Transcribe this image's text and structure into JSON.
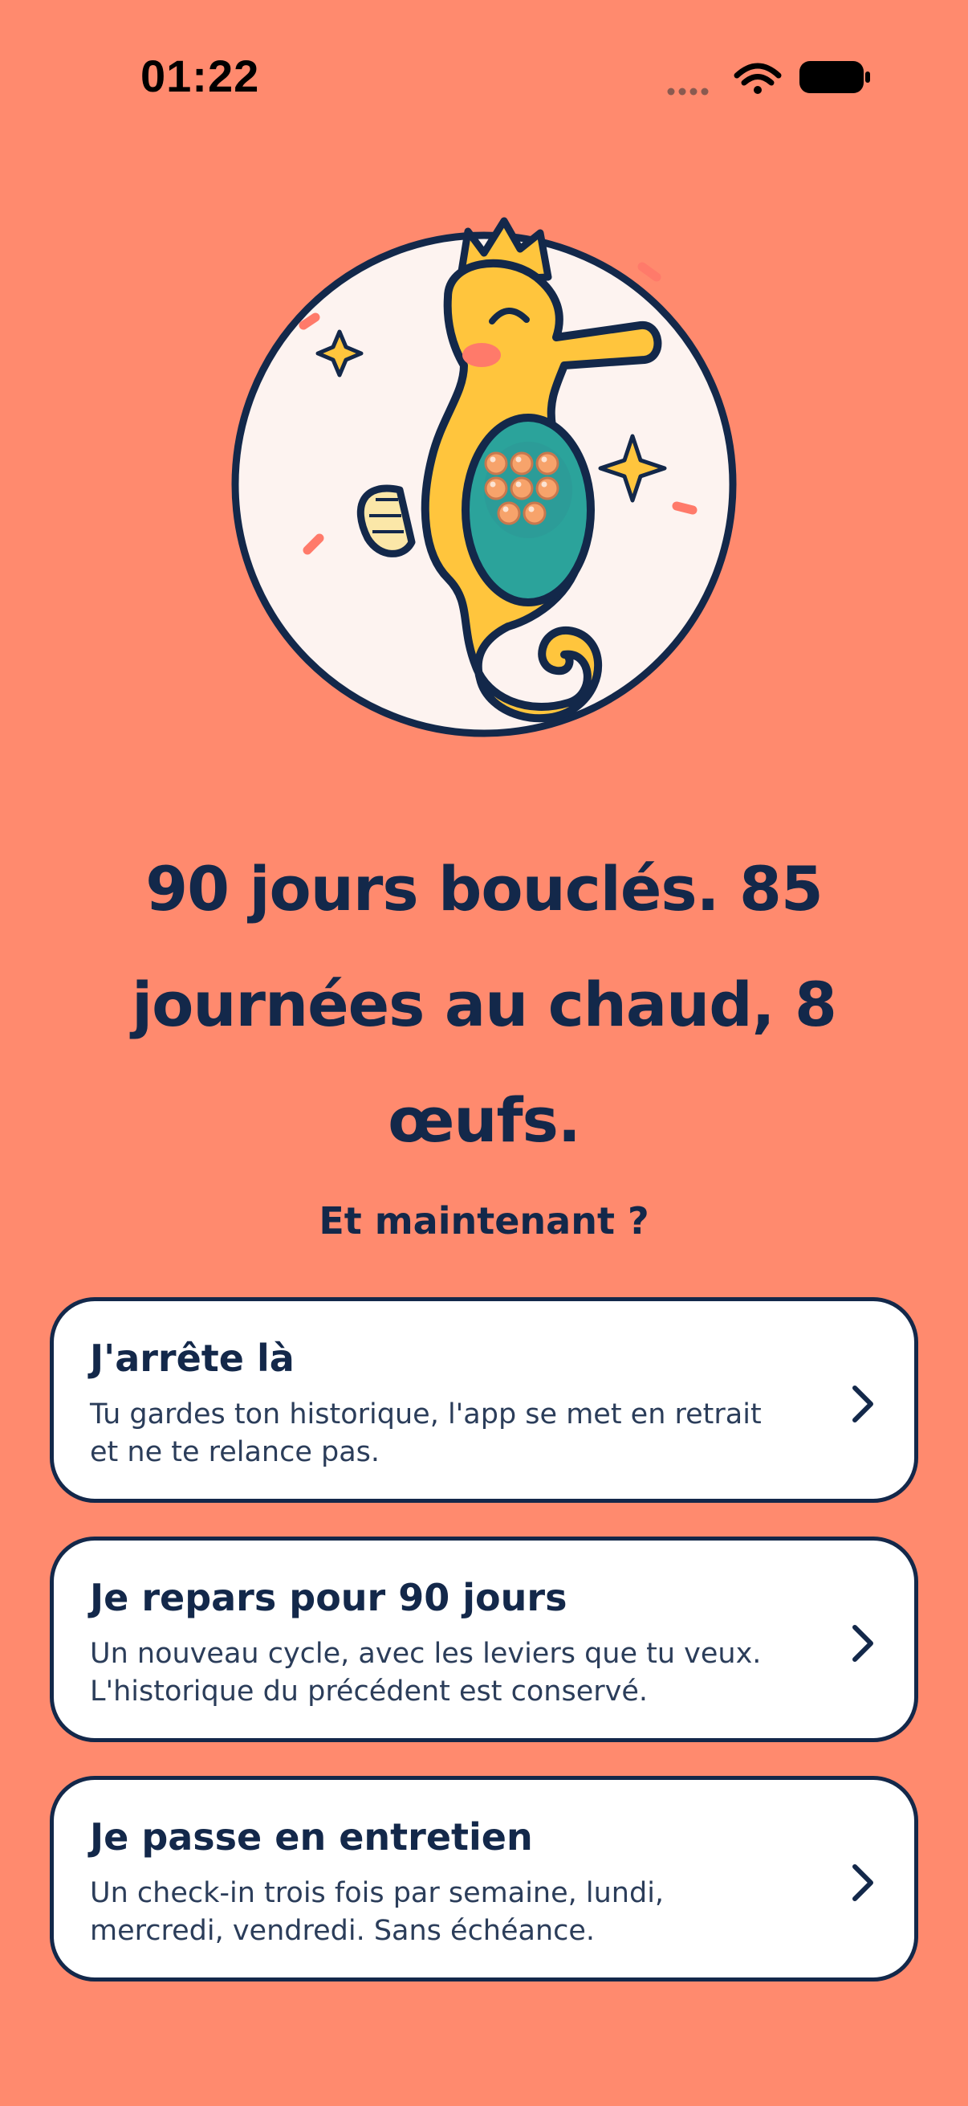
{
  "status_bar": {
    "time": "01:22",
    "icons": [
      "signal-dots-icon",
      "wifi-icon",
      "battery-icon"
    ]
  },
  "illustration": {
    "subject": "seahorse-icon"
  },
  "headline": "90 jours bouclés. 85 journées au chaud, 8 œufs.",
  "subhead": "Et maintenant ?",
  "options": [
    {
      "title": "J'arrête là",
      "description": "Tu gardes ton historique, l'app se met en retrait et ne te relance pas.",
      "icon": "chevron-right-icon"
    },
    {
      "title": "Je repars pour 90 jours",
      "description": "Un nouveau cycle, avec les leviers que tu veux. L'historique du précédent est conservé.",
      "icon": "chevron-right-icon"
    },
    {
      "title": "Je passe en entretien",
      "description": "Un check-in trois fois par semaine, lundi, mercredi, vendredi. Sans échéance.",
      "icon": "chevron-right-icon"
    }
  ],
  "colors": {
    "background": "#FF8A6E",
    "ink": "#13284A",
    "card": "#FFFFFF",
    "seahorse_body": "#FFC53D",
    "belly": "#2BA39B",
    "eggs": "#F7A36B",
    "circle_fill": "#FDF3F0"
  }
}
